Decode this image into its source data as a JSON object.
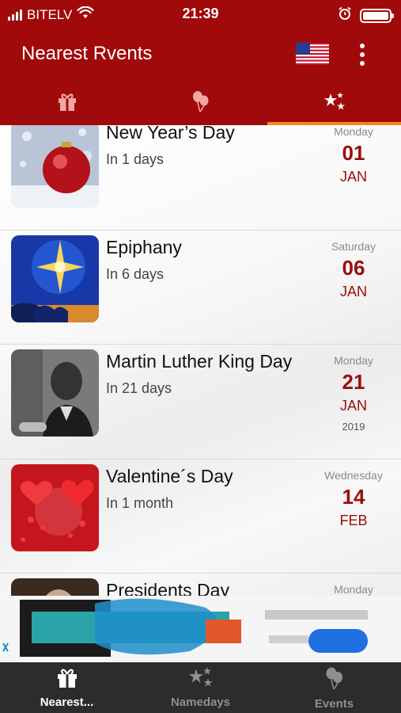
{
  "status_bar": {
    "carrier": "BITELV",
    "time": "21:39"
  },
  "header": {
    "title": "Nearest Rvents",
    "flag_icon": "us-flag-icon",
    "menu_icon": "more-vertical-icon"
  },
  "top_tabs": [
    {
      "icon": "gift-icon",
      "active": false
    },
    {
      "icon": "balloons-icon",
      "active": false
    },
    {
      "icon": "stars-icon",
      "active": true
    }
  ],
  "events": [
    {
      "title": "New Year’s Day",
      "subtitle": "In 1 days",
      "weekday": "Monday",
      "day": "01",
      "month": "JAN",
      "year": "",
      "image": "christmas-ornament"
    },
    {
      "title": "Epiphany",
      "subtitle": "In 6 days",
      "weekday": "Saturday",
      "day": "06",
      "month": "JAN",
      "year": "",
      "image": "star-of-bethlehem"
    },
    {
      "title": "Martin Luther King Day",
      "subtitle": "In 21 days",
      "weekday": "Monday",
      "day": "21",
      "month": "JAN",
      "year": "2019",
      "image": "portrait-photo"
    },
    {
      "title": "Valentine´s Day",
      "subtitle": "In 1 month",
      "weekday": "Wednesday",
      "day": "14",
      "month": "FEB",
      "year": "",
      "image": "red-hearts"
    },
    {
      "title": "Presidents Day",
      "subtitle": "",
      "weekday": "Monday",
      "day": "",
      "month": "",
      "year": "",
      "image": "portrait-photo"
    }
  ],
  "bottom_tabs": [
    {
      "label": "Nearest...",
      "icon": "gift-icon",
      "active": true
    },
    {
      "label": "Namedays",
      "icon": "stars-icon",
      "active": false
    },
    {
      "label": "Events",
      "icon": "balloons-icon",
      "active": false
    }
  ],
  "colors": {
    "header": "#a10a0a",
    "accent_tab": "#f28a1e",
    "date": "#9c0c0c",
    "bottom_bar": "#2c2c2c"
  }
}
